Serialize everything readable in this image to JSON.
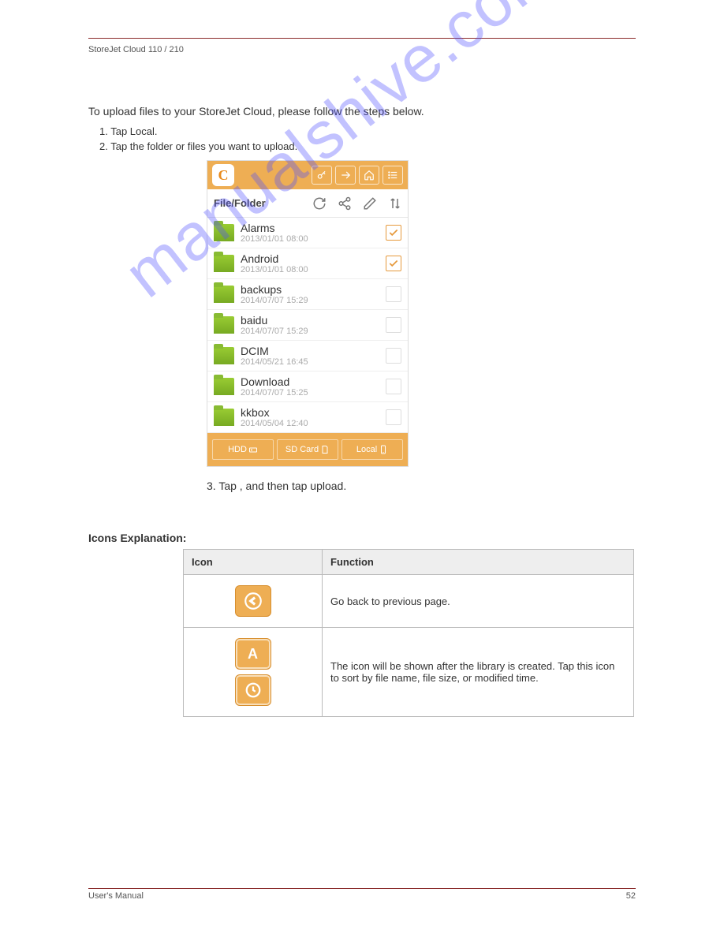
{
  "header": {
    "left": "StoreJet Cloud 110 / 210",
    "right": ""
  },
  "intro": "To upload files to your StoreJet Cloud, please follow the steps below.",
  "steps": {
    "s1": "1.  Tap Local.",
    "s2": "2.  Tap the folder or files you want to upload."
  },
  "phone": {
    "toolbar_label": "File/Folder",
    "rows": [
      {
        "name": "Alarms",
        "date": "2013/01/01 08:00",
        "checked": true
      },
      {
        "name": "Android",
        "date": "2013/01/01 08:00",
        "checked": true
      },
      {
        "name": "backups",
        "date": "2014/07/07 15:29",
        "checked": false
      },
      {
        "name": "baidu",
        "date": "2014/07/07 15:29",
        "checked": false
      },
      {
        "name": "DCIM",
        "date": "2014/05/21 16:45",
        "checked": false
      },
      {
        "name": "Download",
        "date": "2014/07/07 15:25",
        "checked": false
      },
      {
        "name": "kkbox",
        "date": "2014/05/04 12:40",
        "checked": false
      }
    ],
    "tabs": {
      "hdd": "HDD",
      "sd": "SD Card",
      "local": "Local"
    }
  },
  "caption": "3.  Tap    , and then tap upload.",
  "exp_heading": "Icons Explanation:",
  "table": {
    "h_icon": "Icon",
    "h_func": "Function",
    "r1": "Go back to previous page.",
    "r2": "The icon will be shown after the library is created. Tap this icon to sort by file name, file size, or modified time."
  },
  "footer": {
    "left": "User's Manual",
    "right": "52"
  },
  "watermark": "manualshive.com"
}
